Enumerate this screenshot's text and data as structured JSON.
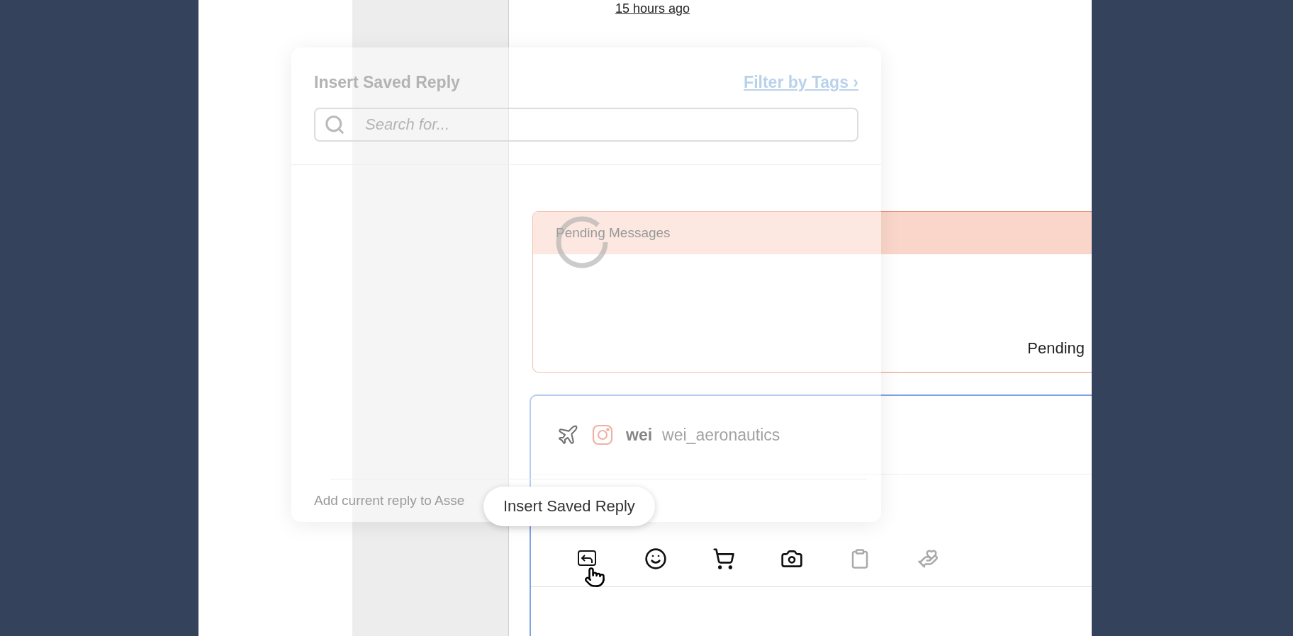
{
  "timestamp": "15 hours ago",
  "saved_reply_popup": {
    "title": "Insert Saved Reply",
    "filter_link": "Filter by Tags ›",
    "search": {
      "placeholder": "Search for..."
    },
    "footer": "Add current reply to Asse"
  },
  "pending": {
    "title": "Pending Messages",
    "status": "Pending"
  },
  "composer": {
    "account": {
      "name": "wei",
      "handle": "wei_aeronautics"
    },
    "tools": [
      {
        "kind": "saved-reply",
        "disabled": false
      },
      {
        "kind": "emoji",
        "disabled": false
      },
      {
        "kind": "cart",
        "disabled": false
      },
      {
        "kind": "camera",
        "disabled": false
      },
      {
        "kind": "clipboard",
        "disabled": true
      },
      {
        "kind": "hand",
        "disabled": true
      }
    ]
  },
  "tooltip": "Insert Saved Reply"
}
